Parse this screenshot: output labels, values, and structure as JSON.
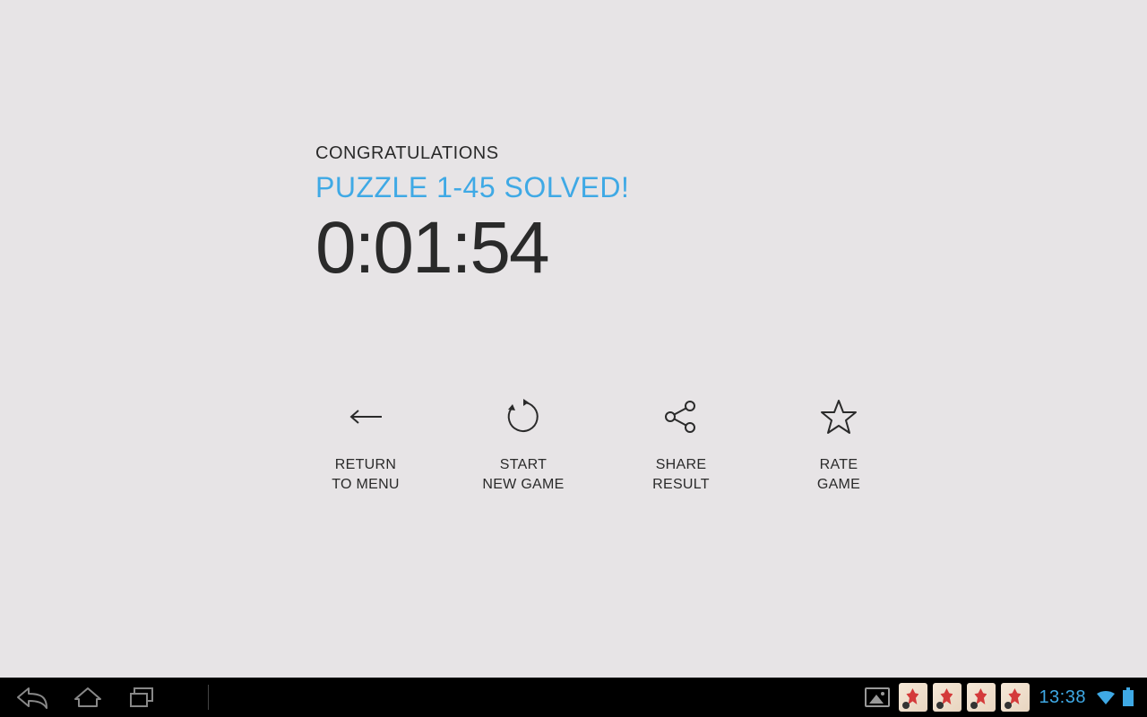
{
  "header": {
    "congrats": "CONGRATULATIONS",
    "solved": "PUZZLE 1-45 SOLVED!",
    "time": "0:01:54"
  },
  "actions": {
    "return": "RETURN\nTO MENU",
    "start": "START\nNEW GAME",
    "share": "SHARE\nRESULT",
    "rate": "RATE\nGAME"
  },
  "navbar": {
    "clock": "13:38"
  },
  "colors": {
    "accent": "#3fa9e5",
    "bg": "#e7e4e6",
    "text": "#2a2a2a"
  }
}
